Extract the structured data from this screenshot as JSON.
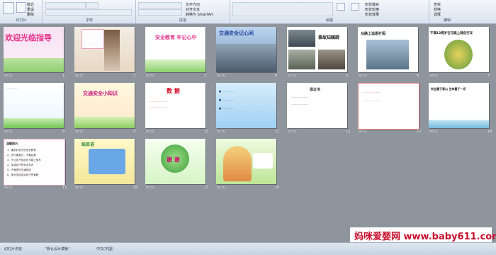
{
  "ribbon": {
    "groups": [
      {
        "label": "幻灯片"
      },
      {
        "label": "字体"
      },
      {
        "label": "段落"
      },
      {
        "label": "绘图"
      },
      {
        "label": "编辑"
      }
    ],
    "paste_label": "粘贴",
    "new_slide_label": "新建\n幻灯片",
    "layout_label": "版式",
    "reset_label": "重设",
    "delete_label": "删除",
    "font_size_value": "",
    "font_size_value2": "",
    "text_direction_label": "文字方向",
    "align_text_label": "对齐文本",
    "smartart_label": "转换为 SmartArt",
    "shape_fill_label": "形状填充",
    "shape_outline_label": "形状轮廓",
    "shape_effect_label": "形状效果",
    "arrange_label": "排列",
    "quick_styles_label": "快速样式",
    "find_label": "查找",
    "replace_label": "替换",
    "select_label": "选择"
  },
  "slides": [
    {
      "num": "1",
      "time": "00:10",
      "title": "欢迎光临指导"
    },
    {
      "num": "2",
      "time": "00:10",
      "title": ""
    },
    {
      "num": "3",
      "time": "00:10",
      "title": "安全教育 牢记心中"
    },
    {
      "num": "4",
      "time": "00:10",
      "title": "交通安全记心间"
    },
    {
      "num": "5",
      "time": "00:10",
      "title": "事故知蹊跷"
    },
    {
      "num": "6",
      "time": "00:10",
      "title": "马路上追逐打闹"
    },
    {
      "num": "7",
      "time": "00:10",
      "title": "不满12周岁在马路上骑自行车"
    },
    {
      "num": "8",
      "time": "00:10",
      "title": ""
    },
    {
      "num": "9",
      "time": "00:10",
      "title": "交通安全小知识"
    },
    {
      "num": "10",
      "time": "00:10",
      "title": "数 据"
    },
    {
      "num": "11",
      "time": "00:10",
      "title": ""
    },
    {
      "num": "12",
      "time": "00:10",
      "title": "倡议书"
    },
    {
      "num": "13",
      "time": "00:10",
      "title": ""
    },
    {
      "num": "14",
      "time": "00:10",
      "title": "安全重于泰山 生命重于一切"
    },
    {
      "num": "15",
      "time": "00:10",
      "title": "温馨提示："
    },
    {
      "num": "16",
      "time": "00:10",
      "title": "结束语"
    },
    {
      "num": "17",
      "time": "00:10",
      "title": "谢 谢"
    },
    {
      "num": "18",
      "time": "00:10",
      "title": ""
    }
  ],
  "slide15_items": [
    "1、要抓好孩子的安全教育",
    "2、步行要靠右，不要乱跑",
    "3、不让孩子独自在马路上骑车",
    "4、加强孩子的安全意识",
    "5、严格遵守交通规则",
    "6、家长多加强对孩子的管教"
  ],
  "status": {
    "view_label": "幻灯片浏览",
    "theme_label": "\"默认设计模板\"",
    "lang_label": "中文(中国)"
  },
  "watermark": "妈咪爱婴网 www.baby611.com",
  "colors": {
    "canvas": "#8f959c",
    "ribbon": "#dbe5f1",
    "watermark": "#c8102e"
  }
}
